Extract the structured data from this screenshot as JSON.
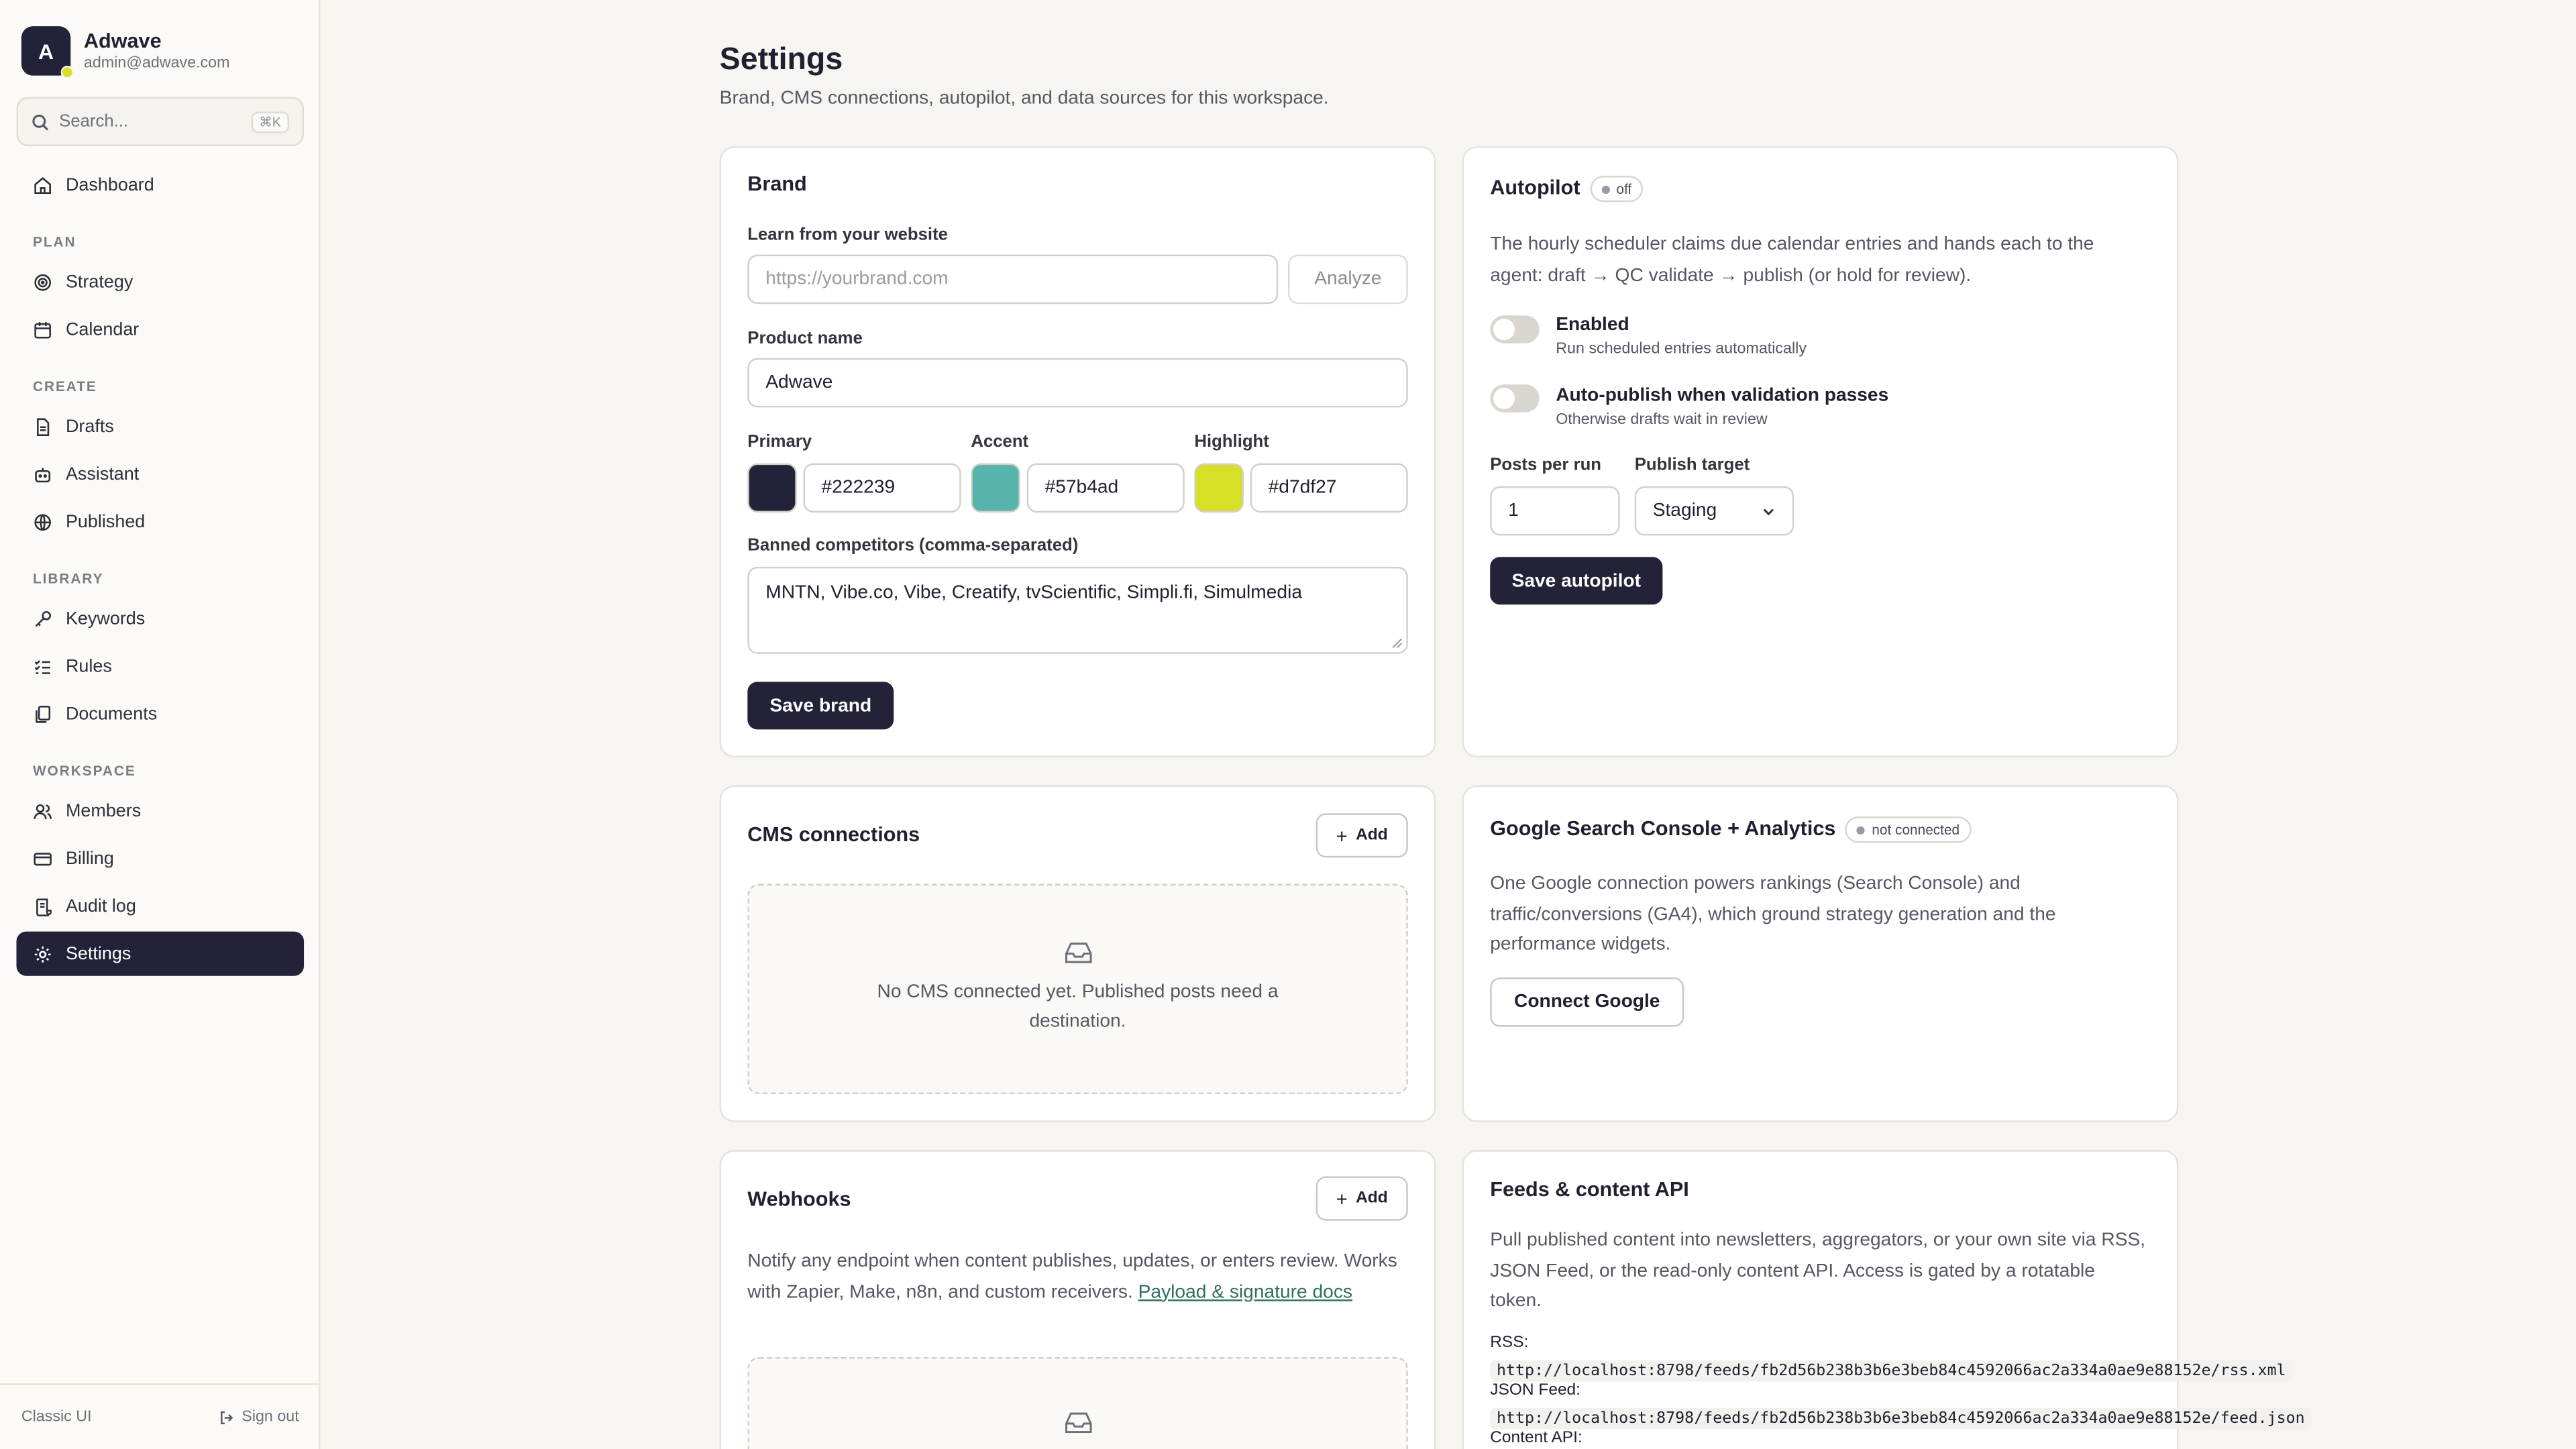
{
  "workspace": {
    "initial": "A",
    "name": "Adwave",
    "email": "admin@adwave.com"
  },
  "search": {
    "placeholder": "Search...",
    "shortcut": "⌘K"
  },
  "nav": {
    "dashboard": "Dashboard",
    "plan_label": "PLAN",
    "strategy": "Strategy",
    "calendar": "Calendar",
    "create_label": "CREATE",
    "drafts": "Drafts",
    "assistant": "Assistant",
    "published": "Published",
    "library_label": "LIBRARY",
    "keywords": "Keywords",
    "rules": "Rules",
    "documents": "Documents",
    "workspace_label": "WORKSPACE",
    "members": "Members",
    "billing": "Billing",
    "audit_log": "Audit log",
    "settings": "Settings"
  },
  "footer": {
    "classic": "Classic UI",
    "signout": "Sign out"
  },
  "page": {
    "title": "Settings",
    "subtitle": "Brand, CMS connections, autopilot, and data sources for this workspace."
  },
  "brand": {
    "title": "Brand",
    "learn_label": "Learn from your website",
    "url_placeholder": "https://yourbrand.com",
    "analyze": "Analyze",
    "product_label": "Product name",
    "product_value": "Adwave",
    "primary_label": "Primary",
    "primary_value": "#222239",
    "accent_label": "Accent",
    "accent_value": "#57b4ad",
    "highlight_label": "Highlight",
    "highlight_value": "#d7df27",
    "banned_label": "Banned competitors (comma-separated)",
    "banned_value": "MNTN, Vibe.co, Vibe, Creatify, tvScientific, Simpli.fi, Simulmedia",
    "save": "Save brand"
  },
  "autopilot": {
    "title": "Autopilot",
    "status": "off",
    "description": "The hourly scheduler claims due calendar entries and hands each to the agent: draft → QC validate → publish (or hold for review).",
    "enabled_title": "Enabled",
    "enabled_sub": "Run scheduled entries automatically",
    "auto_title": "Auto-publish when validation passes",
    "auto_sub": "Otherwise drafts wait in review",
    "posts_label": "Posts per run",
    "posts_value": "1",
    "target_label": "Publish target",
    "target_value": "Staging",
    "save": "Save autopilot"
  },
  "cms": {
    "title": "CMS connections",
    "add": "Add",
    "empty_line1": "No CMS connected yet. Published posts need a",
    "empty_line2": "destination."
  },
  "google": {
    "title": "Google Search Console + Analytics",
    "status": "not connected",
    "description": "One Google connection powers rankings (Search Console) and traffic/conversions (GA4), which ground strategy generation and the performance widgets.",
    "connect": "Connect Google"
  },
  "webhooks": {
    "title": "Webhooks",
    "add": "Add",
    "description": "Notify any endpoint when content publishes, updates, or enters review. Works with Zapier, Make, n8n, and custom receivers.",
    "link": "Payload & signature docs"
  },
  "feeds": {
    "title": "Feeds & content API",
    "description": "Pull published content into newsletters, aggregators, or your own site via RSS, JSON Feed, or the read-only content API. Access is gated by a rotatable token.",
    "rss_label": "RSS:",
    "rss_url": "http://localhost:8798/feeds/fb2d56b238b3b6e3beb84c4592066ac2a334a0ae9e88152e/rss.xml",
    "json_label": "JSON Feed:",
    "json_url": "http://localhost:8798/feeds/fb2d56b238b3b6e3beb84c4592066ac2a334a0ae9e88152e/feed.json",
    "api_label": "Content API:"
  },
  "colors": {
    "primary": "#222239",
    "accent": "#57b4ad",
    "highlight": "#d7df27"
  }
}
